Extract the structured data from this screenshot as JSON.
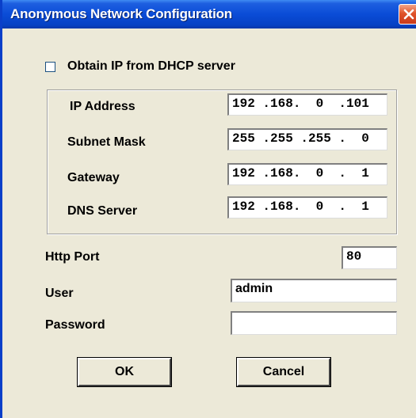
{
  "window": {
    "title": "Anonymous Network Configuration"
  },
  "dhcp": {
    "label": "Obtain IP from DHCP server",
    "checked": false
  },
  "network": {
    "ip_address": {
      "label": "IP Address",
      "value": "192 .168.  0  .101"
    },
    "subnet_mask": {
      "label": "Subnet Mask",
      "value": "255 .255 .255 .  0"
    },
    "gateway": {
      "label": "Gateway",
      "value": "192 .168.  0  .  1"
    },
    "dns_server": {
      "label": "DNS Server",
      "value": "192 .168.  0  .  1"
    }
  },
  "http_port": {
    "label": "Http Port",
    "value": "80"
  },
  "user": {
    "label": "User",
    "value": "admin"
  },
  "password": {
    "label": "Password",
    "value": ""
  },
  "buttons": {
    "ok": "OK",
    "cancel": "Cancel"
  },
  "colors": {
    "titlebar": "#0a4cd7",
    "dialog_bg": "#ece9d8",
    "close": "#e0532a"
  },
  "icons": {
    "close": "close-icon"
  }
}
